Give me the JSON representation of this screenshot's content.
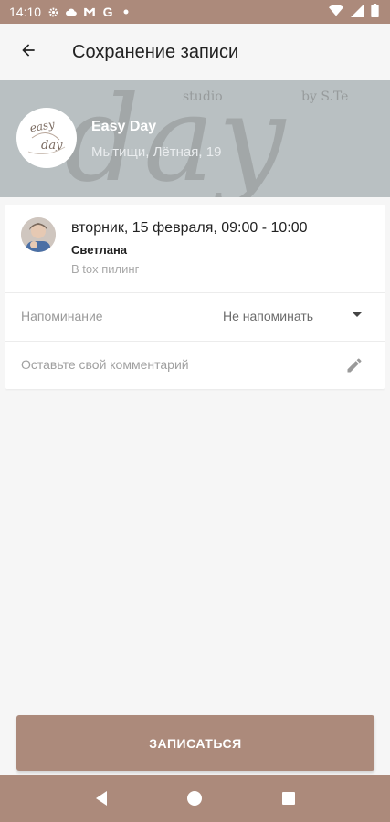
{
  "status_bar": {
    "time": "14:10",
    "icons": [
      "settings-icon",
      "cloud-icon",
      "gmail-icon",
      "google-icon",
      "dot-icon"
    ],
    "right_icons": [
      "wifi-icon",
      "signal-icon",
      "battery-icon"
    ],
    "color": "#ac8a7b"
  },
  "app_bar": {
    "title": "Сохранение записи",
    "back_icon": "arrow-left-icon"
  },
  "salon": {
    "name": "Easy Day",
    "address": "Мытищи, Лётная, 19",
    "logo_text_top": "easy",
    "logo_text_bottom": "day",
    "bg_word": "day",
    "bg_small_left": "studio",
    "bg_small_right": "by S.Te"
  },
  "appointment": {
    "datetime": "вторник, 15 февраля, 09:00 - 10:00",
    "master": "Светлана",
    "service": "B tox пилинг"
  },
  "reminder": {
    "label": "Напоминание",
    "value": "Не напоминать"
  },
  "comment": {
    "placeholder": "Оставьте свой комментарий"
  },
  "submit": {
    "label": "ЗАПИСАТЬСЯ"
  },
  "nav_bar": {
    "back": "nav-back-icon",
    "home": "nav-home-icon",
    "recents": "nav-recents-icon"
  },
  "colors": {
    "accent": "#ac8a7b",
    "background": "#f6f6f6"
  }
}
